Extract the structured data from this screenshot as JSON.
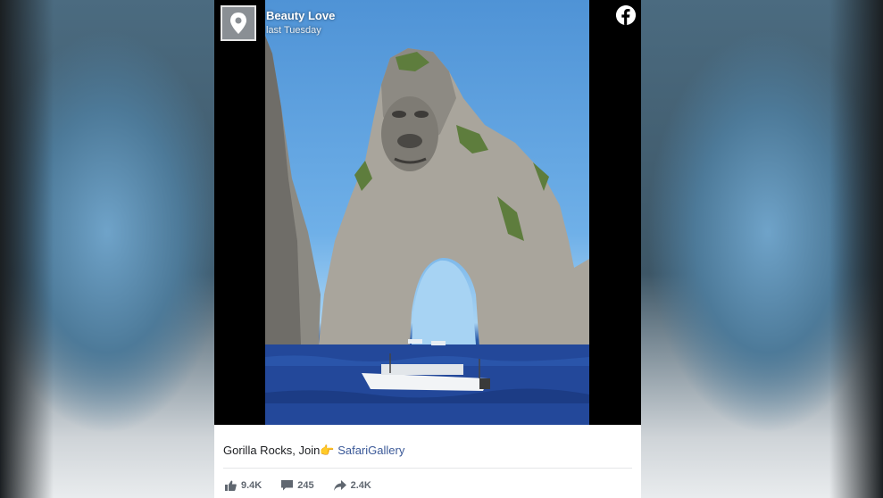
{
  "post": {
    "page_name": "Beauty Love",
    "time": "last Tuesday",
    "avatar_icon": "location-pin-icon",
    "platform_icon": "facebook-icon",
    "caption_text": "Gorilla Rocks, Join",
    "caption_emoji": "👉",
    "caption_link": "SafariGallery",
    "image_description_icon": "gorilla-rock-photo"
  },
  "stats": {
    "likes": "9.4K",
    "comments": "245",
    "shares": "2.4K"
  },
  "colors": {
    "link": "#3b5998",
    "muted": "#606770",
    "sky": "#6fb0e8",
    "sea": "#1d3f86"
  }
}
